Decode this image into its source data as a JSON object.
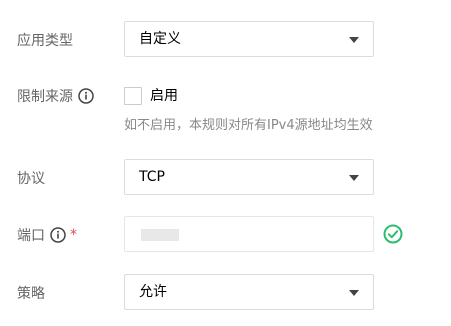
{
  "app_type": {
    "label": "应用类型",
    "value": "自定义"
  },
  "source_limit": {
    "label": "限制来源",
    "icon": "info-icon",
    "checkbox_label": "启用",
    "checked": false,
    "hint": "如不启用，本规则对所有IPv4源地址均生效"
  },
  "protocol": {
    "label": "协议",
    "value": "TCP"
  },
  "port": {
    "label": "端口",
    "icon": "info-icon",
    "required_mark": "*",
    "status_icon": "check-circle-icon",
    "status_color": "#2dbd6e"
  },
  "policy": {
    "label": "策略",
    "value": "允许"
  }
}
